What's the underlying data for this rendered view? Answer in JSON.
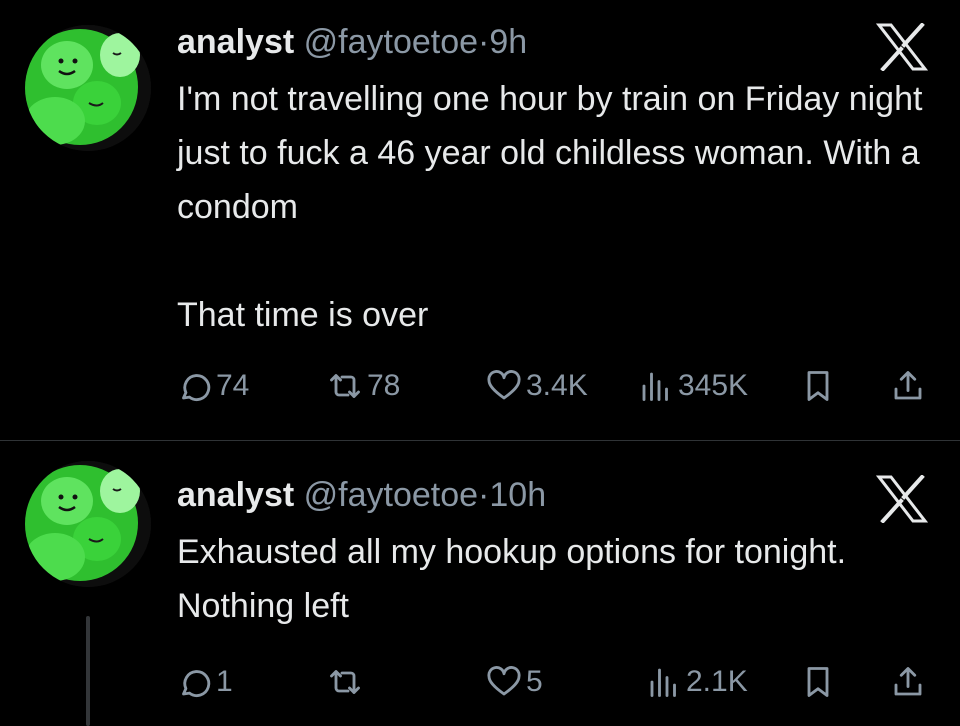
{
  "tweets": [
    {
      "display_name": "analyst",
      "handle": "@faytoetoe",
      "separator": "·",
      "time": "9h",
      "text_paragraphs": [
        "I'm not travelling one hour by train on Friday night just to fuck a 46 year old childless woman. With a condom",
        "That time is over"
      ],
      "replies": "74",
      "reposts": "78",
      "likes": "3.4K",
      "views": "345K"
    },
    {
      "display_name": "analyst",
      "handle": "@faytoetoe",
      "separator": "·",
      "time": "10h",
      "text_paragraphs": [
        "Exhausted all my hookup options for tonight. Nothing left"
      ],
      "replies": "1",
      "reposts": "",
      "likes": "5",
      "views": "2.1K"
    }
  ],
  "colors": {
    "background": "#000000",
    "text": "#e7e9ea",
    "secondary": "#8b98a5",
    "avatar_green": "#3fd13f"
  },
  "icons": [
    "x-logo-icon",
    "reply-icon",
    "repost-icon",
    "like-icon",
    "views-icon",
    "bookmark-icon",
    "share-icon"
  ]
}
